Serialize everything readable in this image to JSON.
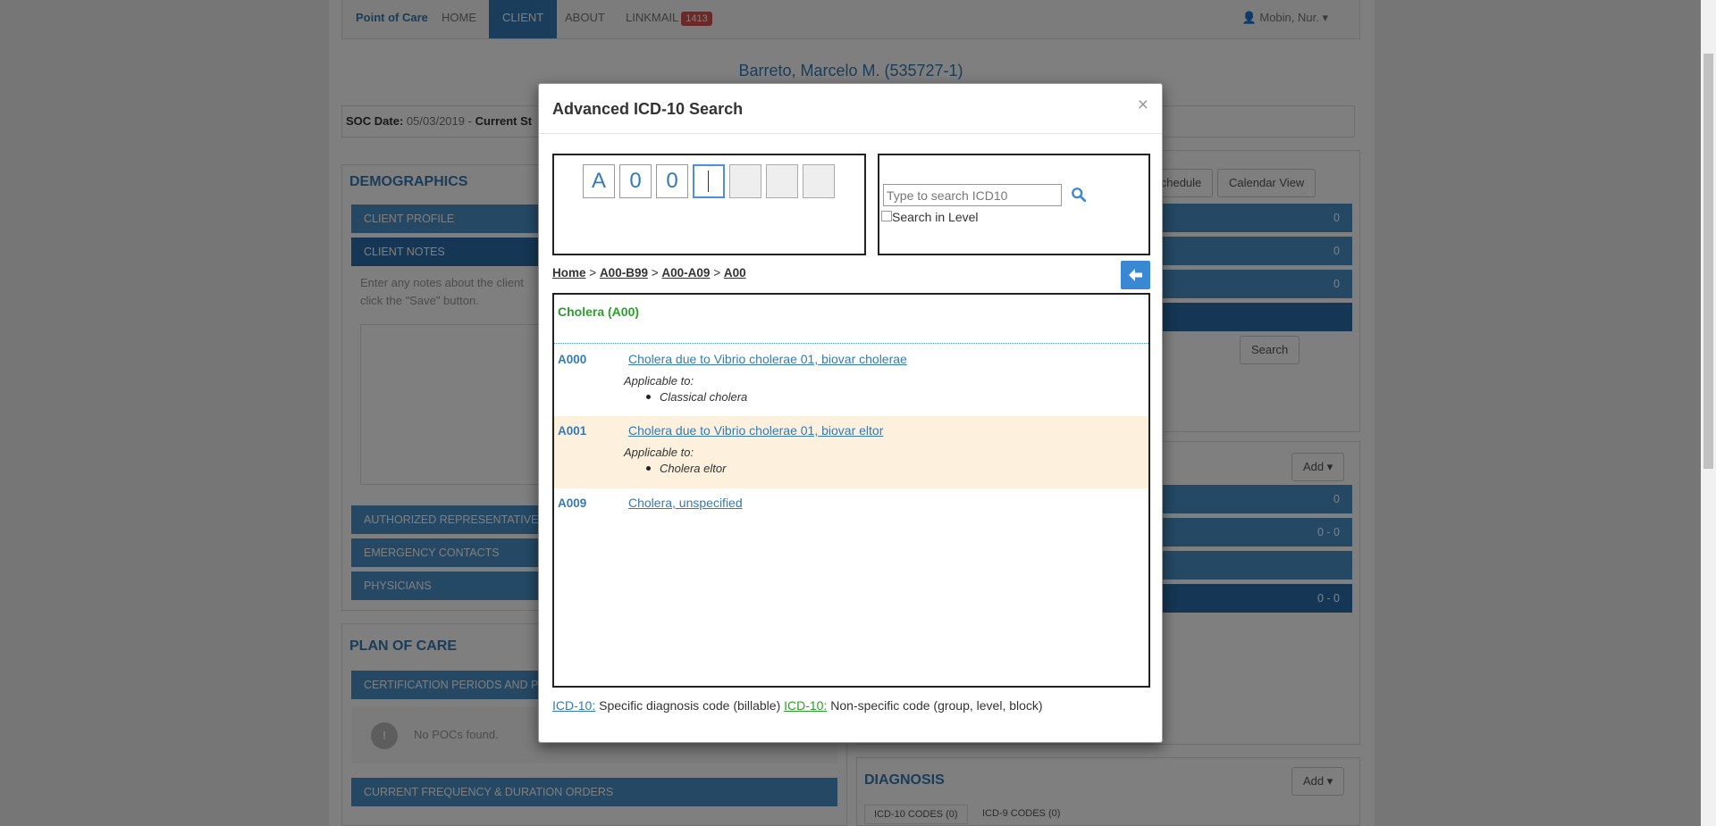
{
  "nav": {
    "brand": "Point of Care",
    "items": [
      "HOME",
      "CLIENT",
      "ABOUT",
      "LINKMAIL"
    ],
    "linkmail_badge": "1413",
    "user": "Mobin, Nur.",
    "active": "CLIENT"
  },
  "patient_title": "Barreto, Marcelo M. (535727-1)",
  "soc": {
    "label": "SOC Date:",
    "value": "05/03/2019 -",
    "current_label": "Current St"
  },
  "demographics": {
    "title": "DEMOGRAPHICS",
    "sections": [
      "CLIENT PROFILE",
      "CLIENT NOTES",
      "AUTHORIZED REPRESENTATIVE",
      "EMERGENCY CONTACTS",
      "PHYSICIANS"
    ],
    "notes_hint_line1": "Enter any notes about the client",
    "notes_hint_line2": "click the \"Save\" button."
  },
  "plan_of_care": {
    "title": "PLAN OF CARE",
    "cert_label": "CERTIFICATION PERIODS AND P",
    "no_pocs": "No POCs found.",
    "freq_label": "CURRENT FREQUENCY & DURATION ORDERS"
  },
  "right_panel": {
    "add_schedule": "dd Schedule",
    "calendar_view": "Calendar View",
    "counts": [
      "0",
      "0",
      "0"
    ],
    "search_btn": "Search",
    "add_label": "Add",
    "counts2": [
      "0",
      "0 - 0",
      "0 - 0"
    ],
    "diagnosis_title": "DIAGNOSIS",
    "icd10_tab": "ICD-10 CODES (0)",
    "icd9_tab": "ICD-9 CODES (0)"
  },
  "modal": {
    "title": "Advanced ICD-10 Search",
    "close": "×",
    "code_chars": [
      "A",
      "0",
      "0",
      "",
      "",
      "",
      ""
    ],
    "search_placeholder": "Type to search ICD10",
    "search_level_label": "Search in Level",
    "breadcrumb": {
      "home": "Home",
      "sep": ">",
      "l1": "A00-B99",
      "l2": "A00-A09",
      "l3": "A00"
    },
    "results_header": "Cholera (A00)",
    "results": [
      {
        "code": "A000",
        "desc": "Cholera due to Vibrio cholerae 01, biovar cholerae",
        "applicable": "Applicable to:",
        "bullet": "Classical cholera"
      },
      {
        "code": "A001",
        "desc": "Cholera due to Vibrio cholerae 01, biovar eltor",
        "applicable": "Applicable to:",
        "bullet": "Cholera eltor"
      },
      {
        "code": "A009",
        "desc": "Cholera, unspecified"
      }
    ],
    "legend": {
      "l1": "ICD-10:",
      "t1": " Specific diagnosis code (billable) ",
      "l2": "ICD-10:",
      "t2": " Non-specific code (group, level, block)"
    }
  },
  "colors": {
    "accent": "#337ab7",
    "nonspecific_green": "#2aa02a",
    "highlight_row": "#fdf0dc"
  }
}
